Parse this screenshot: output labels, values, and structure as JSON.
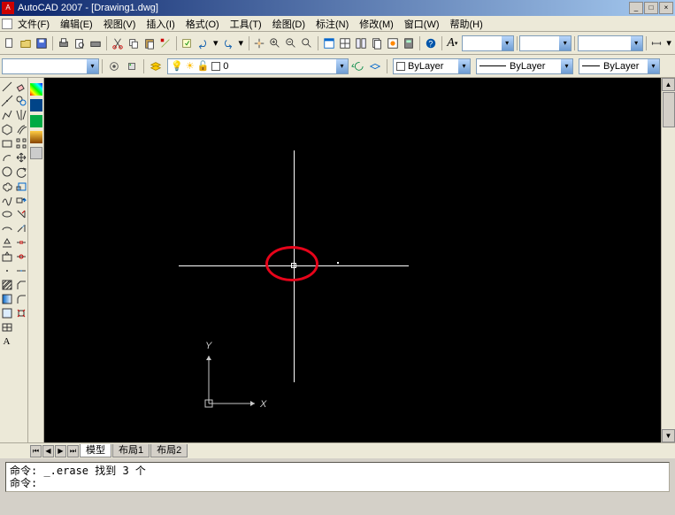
{
  "title": "AutoCAD 2007 - [Drawing1.dwg]",
  "menu": {
    "file": "文件(F)",
    "edit": "编辑(E)",
    "view": "视图(V)",
    "insert": "插入(I)",
    "format": "格式(O)",
    "tools": "工具(T)",
    "draw": "绘图(D)",
    "dimension": "标注(N)",
    "modify": "修改(M)",
    "window": "窗口(W)",
    "help": "帮助(H)"
  },
  "layerbar": {
    "layer_combo": "0",
    "color": "ByLayer",
    "linetype": "ByLayer",
    "lineweight": "ByLayer"
  },
  "tabs": {
    "model": "模型",
    "layout1": "布局1",
    "layout2": "布局2"
  },
  "command": {
    "line1": "命令: _.erase 找到 3 个",
    "line2": "命令:"
  },
  "ucs": {
    "x": "X",
    "y": "Y"
  },
  "textstyle": {
    "value": "A"
  }
}
